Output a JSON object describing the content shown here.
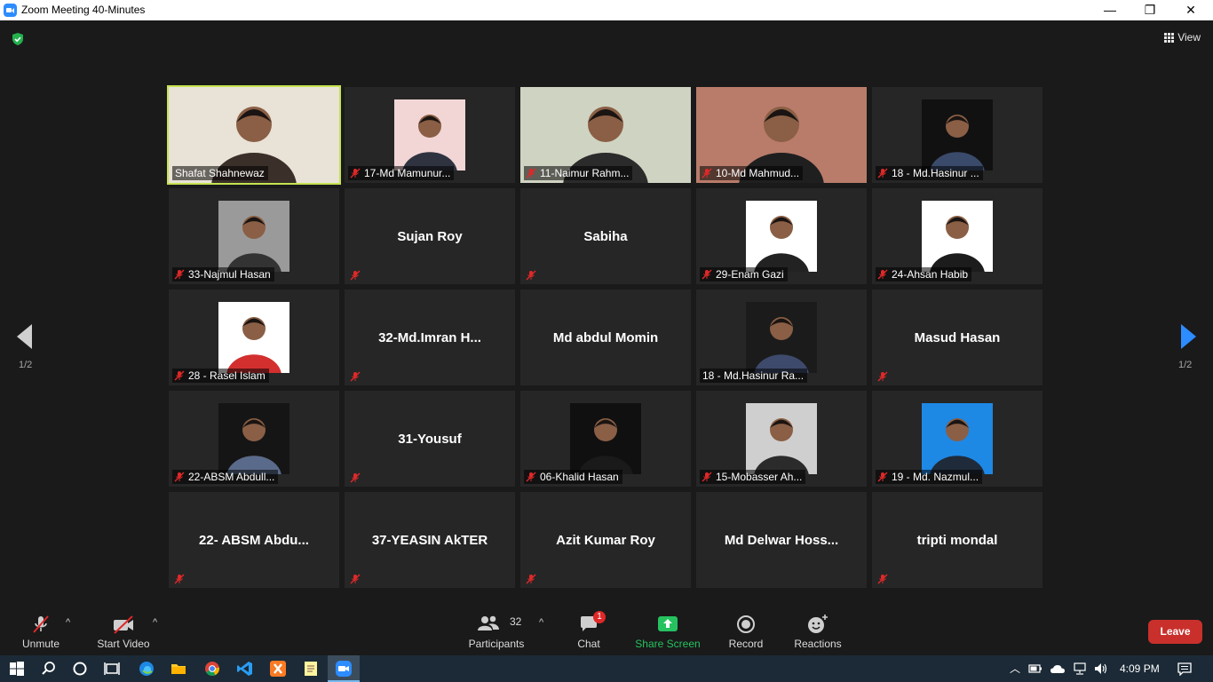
{
  "window": {
    "title": "Zoom Meeting 40-Minutes",
    "minimize": "—",
    "maximize": "❐",
    "close": "✕"
  },
  "header": {
    "view_label": "View"
  },
  "pagination": {
    "left": "1/2",
    "right": "1/2"
  },
  "tiles": [
    {
      "name": "Shafat Shahnewaz",
      "muted": false,
      "kind": "video",
      "active": true
    },
    {
      "name": "17-Md Mamunur...",
      "muted": true,
      "kind": "photo"
    },
    {
      "name": "11-Naimur Rahm...",
      "muted": true,
      "kind": "video"
    },
    {
      "name": "10-Md Mahmud...",
      "muted": true,
      "kind": "video"
    },
    {
      "name": "18 - Md.Hasinur ...",
      "muted": true,
      "kind": "photo"
    },
    {
      "name": "33-Najmul Hasan",
      "muted": true,
      "kind": "photo"
    },
    {
      "name": "Sujan Roy",
      "muted": true,
      "kind": "text"
    },
    {
      "name": "Sabiha",
      "muted": true,
      "kind": "text"
    },
    {
      "name": "29-Enam Gazi",
      "muted": true,
      "kind": "photo"
    },
    {
      "name": "24-Ahsan Habib",
      "muted": true,
      "kind": "photo"
    },
    {
      "name": "28 - Rasel Islam",
      "muted": true,
      "kind": "photo"
    },
    {
      "name": "32-Md.Imran  H...",
      "muted": true,
      "kind": "text"
    },
    {
      "name": "Md abdul Momin",
      "muted": false,
      "kind": "text"
    },
    {
      "name": "18 - Md.Hasinur Ra...",
      "muted": false,
      "kind": "photo"
    },
    {
      "name": "Masud Hasan",
      "muted": true,
      "kind": "text"
    },
    {
      "name": "22-ABSM Abdull...",
      "muted": true,
      "kind": "photo"
    },
    {
      "name": "31-Yousuf",
      "muted": true,
      "kind": "text"
    },
    {
      "name": "06-Khalid Hasan",
      "muted": true,
      "kind": "photo"
    },
    {
      "name": "15-Mobasser Ah...",
      "muted": true,
      "kind": "photo"
    },
    {
      "name": "19 - Md. Nazmul...",
      "muted": true,
      "kind": "photo"
    },
    {
      "name": "22- ABSM Abdu...",
      "muted": true,
      "kind": "text"
    },
    {
      "name": "37-YEASIN AkTER",
      "muted": true,
      "kind": "text"
    },
    {
      "name": "Azit Kumar Roy",
      "muted": true,
      "kind": "text"
    },
    {
      "name": "Md  Delwar  Hoss...",
      "muted": false,
      "kind": "text"
    },
    {
      "name": "tripti mondal",
      "muted": true,
      "kind": "text"
    }
  ],
  "toolbar": {
    "unmute": "Unmute",
    "start_video": "Start Video",
    "participants": "Participants",
    "participants_count": "32",
    "chat": "Chat",
    "chat_badge": "1",
    "share_screen": "Share Screen",
    "record": "Record",
    "reactions": "Reactions",
    "leave": "Leave",
    "caret": "^"
  },
  "colors": {
    "accent": "#2d8cff",
    "active_speaker": "#c5e351",
    "share": "#25c25f",
    "leave": "#c9302c",
    "muted_icon": "#e02828"
  },
  "taskbar": {
    "time": "4:09 PM"
  }
}
